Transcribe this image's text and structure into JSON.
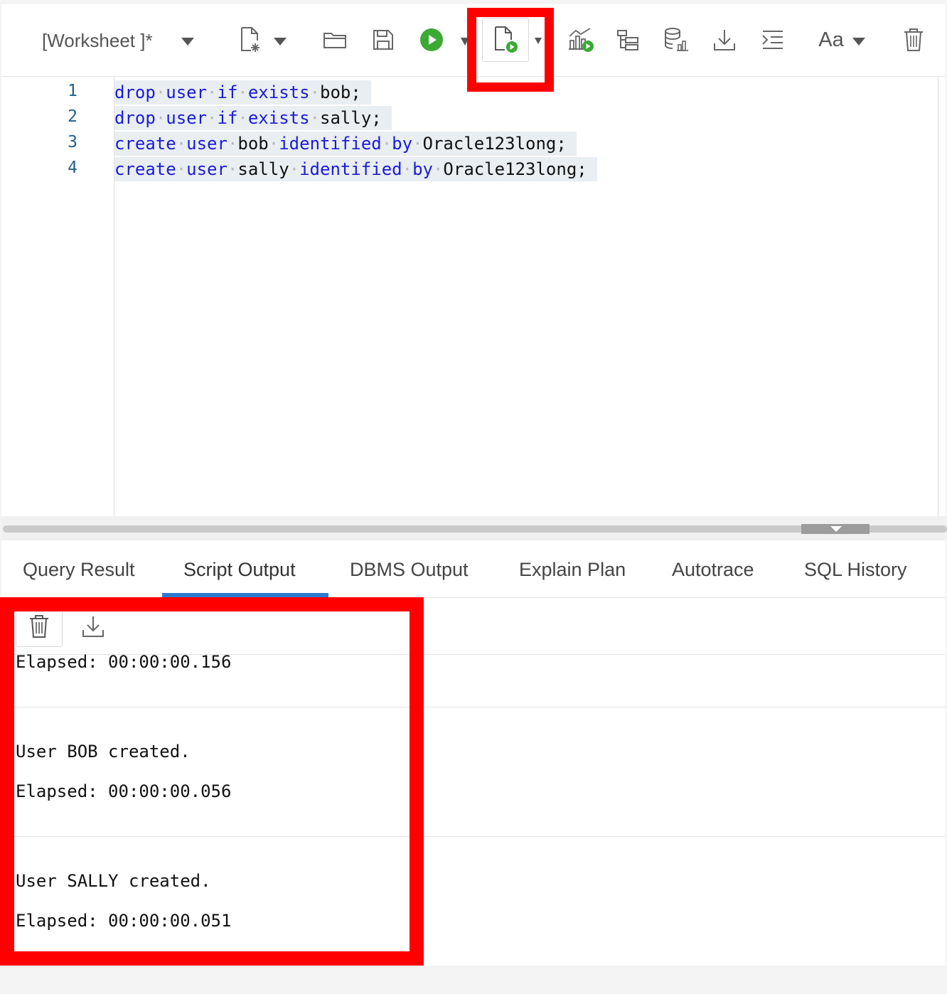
{
  "toolbar": {
    "worksheet_title": "[Worksheet ]*",
    "icons": [
      "new-file-icon",
      "open-folder-icon",
      "save-icon",
      "run-statement-icon",
      "run-script-icon",
      "sql-tuning-icon",
      "explain-plan-icon",
      "database-chart-icon",
      "download-icon",
      "format-indent-icon",
      "font-icon",
      "trash-icon"
    ],
    "font_label": "Aa"
  },
  "editor": {
    "line_numbers": [
      "1",
      "2",
      "3",
      "4"
    ],
    "lines": [
      {
        "tokens": [
          [
            "kw",
            "drop"
          ],
          [
            "dot",
            "·"
          ],
          [
            "kw",
            "user"
          ],
          [
            "dot",
            "·"
          ],
          [
            "kw",
            "if"
          ],
          [
            "dot",
            "·"
          ],
          [
            "kw",
            "exists"
          ],
          [
            "dot",
            "·"
          ],
          [
            "tx",
            "bob;"
          ]
        ]
      },
      {
        "tokens": [
          [
            "kw",
            "drop"
          ],
          [
            "dot",
            "·"
          ],
          [
            "kw",
            "user"
          ],
          [
            "dot",
            "·"
          ],
          [
            "kw",
            "if"
          ],
          [
            "dot",
            "·"
          ],
          [
            "kw",
            "exists"
          ],
          [
            "dot",
            "·"
          ],
          [
            "tx",
            "sally;"
          ]
        ]
      },
      {
        "tokens": [
          [
            "kw",
            "create"
          ],
          [
            "dot",
            "·"
          ],
          [
            "kw",
            "user"
          ],
          [
            "dot",
            "·"
          ],
          [
            "tx",
            "bob"
          ],
          [
            "dot",
            "·"
          ],
          [
            "kw",
            "identified"
          ],
          [
            "dot",
            "·"
          ],
          [
            "kw",
            "by"
          ],
          [
            "dot",
            "·"
          ],
          [
            "tx",
            "Oracle123long;"
          ]
        ]
      },
      {
        "tokens": [
          [
            "kw",
            "create"
          ],
          [
            "dot",
            "·"
          ],
          [
            "kw",
            "user"
          ],
          [
            "dot",
            "·"
          ],
          [
            "tx",
            "sally"
          ],
          [
            "dot",
            "·"
          ],
          [
            "kw",
            "identified"
          ],
          [
            "dot",
            "·"
          ],
          [
            "kw",
            "by"
          ],
          [
            "dot",
            "·"
          ],
          [
            "tx",
            "Oracle123long;"
          ]
        ]
      }
    ]
  },
  "tabs": [
    {
      "label": "Query Result"
    },
    {
      "label": "Script Output",
      "active": true
    },
    {
      "label": "DBMS Output"
    },
    {
      "label": "Explain Plan"
    },
    {
      "label": "Autotrace"
    },
    {
      "label": "SQL History"
    }
  ],
  "output": {
    "lines": [
      "Elapsed: 00:00:00.156",
      "User BOB created.",
      "Elapsed: 00:00:00.056",
      "User SALLY created.",
      "Elapsed: 00:00:00.051"
    ]
  },
  "colors": {
    "highlight": "#ff0000",
    "keyword": "#1b1bd6",
    "active_tab": "#2b7bd0",
    "run_green": "#3aaa35"
  }
}
